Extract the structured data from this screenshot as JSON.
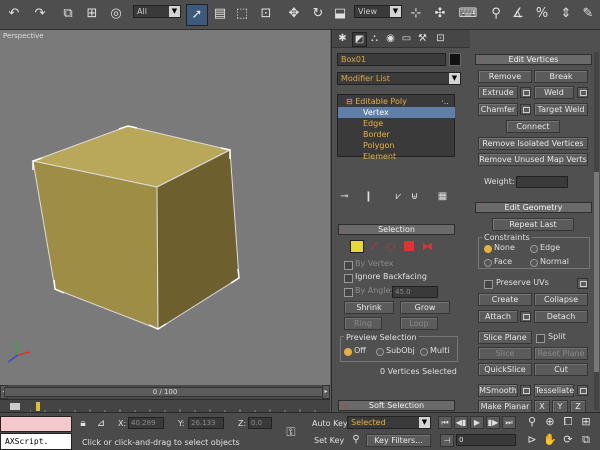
{
  "toolbar": {
    "selection_filter": "All",
    "ref_coord": "View",
    "icons": [
      "undo-icon",
      "redo-icon",
      "select-link-icon",
      "unlink-icon",
      "bind-spacewarp-icon",
      "select-object-icon",
      "select-by-name-icon",
      "rectangular-region-icon",
      "window-crossing-icon",
      "move-icon",
      "rotate-icon",
      "scale-icon",
      "pivot-center-icon",
      "select-manipulate-icon",
      "snaps-toggle-icon",
      "angle-snap-icon",
      "percent-snap-icon",
      "spinner-snap-icon"
    ]
  },
  "viewport": {
    "label": "Perspective",
    "object_color": "#a8974e"
  },
  "timeline": {
    "frame_text": "0 / 100"
  },
  "command_panel": {
    "object_name": "Box01",
    "object_color": "#111111",
    "modifier_list": "Modifier List",
    "stack": [
      {
        "label": "Editable Poly",
        "selected": false,
        "root": true
      },
      {
        "label": "Vertex",
        "selected": true,
        "root": false
      },
      {
        "label": "Edge",
        "selected": false,
        "root": false
      },
      {
        "label": "Border",
        "selected": false,
        "root": false
      },
      {
        "label": "Polygon",
        "selected": false,
        "root": false
      },
      {
        "label": "Element",
        "selected": false,
        "root": false
      }
    ],
    "selection": {
      "title": "Selection",
      "by_vertex": "By Vertex",
      "ignore_backfacing": "Ignore Backfacing",
      "by_angle": "By Angle:",
      "by_angle_value": "45.0",
      "shrink": "Shrink",
      "grow": "Grow",
      "ring": "Ring",
      "loop": "Loop",
      "preview_title": "Preview Selection",
      "preview_off": "Off",
      "preview_subobj": "SubObj",
      "preview_multi": "Multi",
      "status": "0 Vertices Selected"
    },
    "soft_selection_title": "Soft Selection"
  },
  "edit_vertices": {
    "title": "Edit Vertices",
    "remove": "Remove",
    "break": "Break",
    "extrude": "Extrude",
    "weld": "Weld",
    "chamfer": "Chamfer",
    "target_weld": "Target Weld",
    "connect": "Connect",
    "remove_isolated": "Remove Isolated Vertices",
    "remove_unused": "Remove Unused Map Verts",
    "weight_label": "Weight:"
  },
  "edit_geometry": {
    "title": "Edit Geometry",
    "repeat_last": "Repeat Last",
    "constraints_title": "Constraints",
    "none": "None",
    "edge": "Edge",
    "face": "Face",
    "normal": "Normal",
    "preserve_uvs": "Preserve UVs",
    "create": "Create",
    "collapse": "Collapse",
    "attach": "Attach",
    "detach": "Detach",
    "slice_plane": "Slice Plane",
    "split": "Split",
    "slice": "Slice",
    "reset_plane": "Reset Plane",
    "quickslice": "QuickSlice",
    "cut": "Cut",
    "msmooth": "MSmooth",
    "tessellate": "Tessellate",
    "make_planar": "Make Planar",
    "x": "X",
    "y": "Y",
    "z": "Z"
  },
  "status_bar": {
    "maxscript": "AXScript.",
    "prompt": "Click or click-and-drag to select objects",
    "x_label": "X:",
    "x_value": "40.289",
    "y_label": "Y:",
    "y_value": "26.133",
    "z_label": "Z:",
    "z_value": "0.0",
    "auto_key": "Auto Key",
    "set_key": "Set Key",
    "selected": "Selected",
    "key_filters": "Key Filters...",
    "frame": "0"
  }
}
